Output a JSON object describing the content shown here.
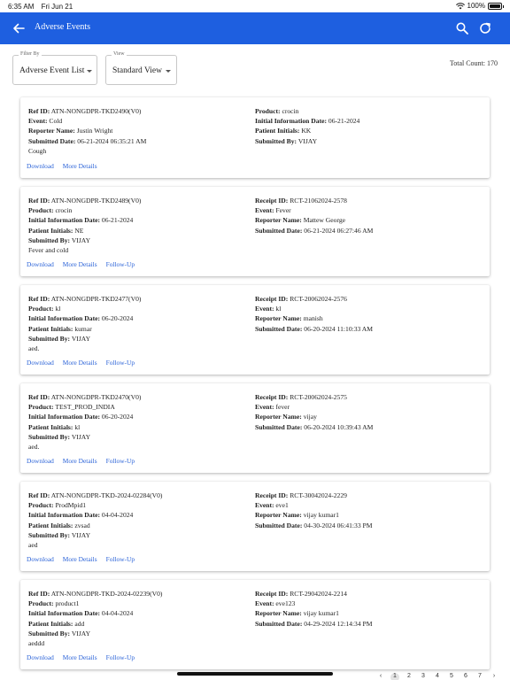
{
  "status_bar": {
    "time": "6:35 AM",
    "date": "Fri Jun 21",
    "battery": "100%",
    "battery_level": 1.0
  },
  "header": {
    "title": "Adverse Events"
  },
  "filter": {
    "legend": "Filter By",
    "value": "Adverse Event List"
  },
  "view": {
    "legend": "View",
    "value": "Standard View"
  },
  "total_count": "Total Count: 170",
  "actions": {
    "download": "Download",
    "more": "More Details",
    "followup": "Follow-Up"
  },
  "cards": [
    {
      "left": [
        {
          "label": "Ref ID:",
          "value": "ATN-NONGDPR-TKD2490(V0)"
        },
        {
          "label": "Event:",
          "value": "Cold"
        },
        {
          "label": "Reporter Name:",
          "value": "Justin Wright"
        },
        {
          "label": "Submitted Date:",
          "value": "06-21-2024 06:35:21 AM"
        },
        {
          "label": "",
          "value": "Cough"
        }
      ],
      "right": [
        {
          "label": "Product:",
          "value": "crocin"
        },
        {
          "label": "Initial Information Date:",
          "value": "06-21-2024"
        },
        {
          "label": "Patient Initials:",
          "value": "KK"
        },
        {
          "label": "Submitted By:",
          "value": "VIJAY"
        }
      ],
      "followup": false
    },
    {
      "left": [
        {
          "label": "Ref ID:",
          "value": "ATN-NONGDPR-TKD2489(V0)"
        },
        {
          "label": "Product:",
          "value": "crocin"
        },
        {
          "label": "Initial Information Date:",
          "value": "06-21-2024"
        },
        {
          "label": "Patient Initials:",
          "value": "NE"
        },
        {
          "label": "Submitted By:",
          "value": "VIJAY"
        },
        {
          "label": "",
          "value": "Fever and cold"
        }
      ],
      "right": [
        {
          "label": "Receipt ID:",
          "value": "RCT-21062024-2578"
        },
        {
          "label": "Event:",
          "value": "Fever"
        },
        {
          "label": "Reporter Name:",
          "value": "Mattew George"
        },
        {
          "label": "Submitted Date:",
          "value": "06-21-2024 06:27:46 AM"
        }
      ],
      "followup": true
    },
    {
      "left": [
        {
          "label": "Ref ID:",
          "value": "ATN-NONGDPR-TKD2477(V0)"
        },
        {
          "label": "Product:",
          "value": "kl"
        },
        {
          "label": "Initial Information Date:",
          "value": "06-20-2024"
        },
        {
          "label": "Patient Initials:",
          "value": "kumar"
        },
        {
          "label": "Submitted By:",
          "value": "VIJAY"
        },
        {
          "label": "",
          "value": "aed."
        }
      ],
      "right": [
        {
          "label": "Receipt ID:",
          "value": "RCT-20062024-2576"
        },
        {
          "label": "Event:",
          "value": "kl"
        },
        {
          "label": "Reporter Name:",
          "value": "manish"
        },
        {
          "label": "Submitted Date:",
          "value": "06-20-2024 11:10:33 AM"
        }
      ],
      "followup": true
    },
    {
      "left": [
        {
          "label": "Ref ID:",
          "value": "ATN-NONGDPR-TKD2470(V0)"
        },
        {
          "label": "Product:",
          "value": "TEST_PROD_INDIA"
        },
        {
          "label": "Initial Information Date:",
          "value": "06-20-2024"
        },
        {
          "label": "Patient Initials:",
          "value": "kl"
        },
        {
          "label": "Submitted By:",
          "value": "VIJAY"
        },
        {
          "label": "",
          "value": "aed."
        }
      ],
      "right": [
        {
          "label": "Receipt ID:",
          "value": "RCT-20062024-2575"
        },
        {
          "label": "Event:",
          "value": "fever"
        },
        {
          "label": "Reporter Name:",
          "value": "vijay"
        },
        {
          "label": "Submitted Date:",
          "value": "06-20-2024 10:39:43 AM"
        }
      ],
      "followup": true
    },
    {
      "left": [
        {
          "label": "Ref ID:",
          "value": "ATN-NONGDPR-TKD-2024-02284(V0)"
        },
        {
          "label": "Product:",
          "value": "ProdMpid1"
        },
        {
          "label": "Initial Information Date:",
          "value": "04-04-2024"
        },
        {
          "label": "Patient Initials:",
          "value": "zvsad"
        },
        {
          "label": "Submitted By:",
          "value": "VIJAY"
        },
        {
          "label": "",
          "value": "aed"
        }
      ],
      "right": [
        {
          "label": "Receipt ID:",
          "value": "RCT-30042024-2229"
        },
        {
          "label": "Event:",
          "value": "eve1"
        },
        {
          "label": "Reporter Name:",
          "value": "vijay kumar1"
        },
        {
          "label": "Submitted Date:",
          "value": "04-30-2024 06:41:33 PM"
        }
      ],
      "followup": true
    },
    {
      "left": [
        {
          "label": "Ref ID:",
          "value": "ATN-NONGDPR-TKD-2024-02239(V0)"
        },
        {
          "label": "Product:",
          "value": "product1"
        },
        {
          "label": "Initial Information Date:",
          "value": "04-04-2024"
        },
        {
          "label": "Patient Initials:",
          "value": "add"
        },
        {
          "label": "Submitted By:",
          "value": "VIJAY"
        },
        {
          "label": "",
          "value": "aeddd"
        }
      ],
      "right": [
        {
          "label": "Receipt ID:",
          "value": "RCT-29042024-2214"
        },
        {
          "label": "Event:",
          "value": "eve123"
        },
        {
          "label": "Reporter Name:",
          "value": "vijay kumar1"
        },
        {
          "label": "Submitted Date:",
          "value": "04-29-2024 12:14:34 PM"
        }
      ],
      "followup": true
    }
  ],
  "pagination": {
    "prev": "‹",
    "pages": [
      "1",
      "2",
      "3",
      "4",
      "5",
      "6",
      "7"
    ],
    "active": "1",
    "next": "›"
  },
  "colors": {
    "app_bar": "#1e5fe0",
    "link": "#2b63d8"
  }
}
